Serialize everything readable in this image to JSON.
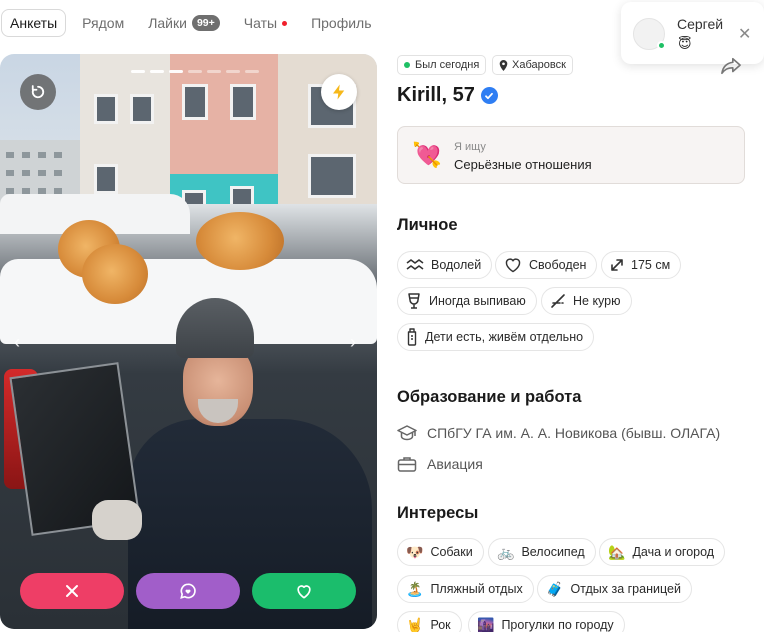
{
  "nav": {
    "items": [
      {
        "label": "Анкеты",
        "active": true
      },
      {
        "label": "Рядом"
      },
      {
        "label": "Лайки",
        "badge": "99+"
      },
      {
        "label": "Чаты",
        "unread_dot": true
      },
      {
        "label": "Профиль"
      }
    ]
  },
  "toast": {
    "name": "Сергей",
    "emoji": "😇"
  },
  "photo": {
    "photo_count": 7,
    "current_index": 1,
    "prev_arrow": "‹",
    "next_arrow": "›"
  },
  "profile": {
    "status": "Был сегодня",
    "city": "Хабаровск",
    "name_age": "Kirill, 57",
    "seeking": {
      "label": "Я ищу",
      "value": "Серьёзные отношения",
      "icon": "💘"
    }
  },
  "sections": {
    "personal": "Личное",
    "education": "Образование и работа",
    "interests": "Интересы"
  },
  "personal_chips": [
    {
      "label": "Водолей",
      "icon": "aquarius-icon"
    },
    {
      "label": "Свободен",
      "icon": "heart-outline-icon"
    },
    {
      "label": "175 см",
      "icon": "height-arrows-icon"
    },
    {
      "label": "Иногда выпиваю",
      "icon": "wine-glass-icon"
    },
    {
      "label": "Не курю",
      "icon": "no-smoking-icon"
    },
    {
      "label": "Дети есть, живём отдельно",
      "icon": "baby-bottle-icon"
    }
  ],
  "education": {
    "university": "СПбГУ ГА им. А. А. Новикова (бывш. ОЛАГА)",
    "work": "Авиация"
  },
  "interests": [
    {
      "label": "Собаки",
      "emoji": "🐶"
    },
    {
      "label": "Велосипед",
      "emoji": "🚲"
    },
    {
      "label": "Дача и огород",
      "emoji": "🏡"
    },
    {
      "label": "Пляжный отдых",
      "emoji": "🏝️"
    },
    {
      "label": "Отдых за границей",
      "emoji": "🧳"
    },
    {
      "label": "Рок",
      "emoji": "🤘"
    },
    {
      "label": "Прогулки по городу",
      "emoji": "🌆"
    }
  ],
  "colors": {
    "skip": "#ee3e66",
    "message": "#a15ec9",
    "like": "#1bbd6c",
    "online": "#1fc065",
    "verified": "#2f7ef3"
  }
}
